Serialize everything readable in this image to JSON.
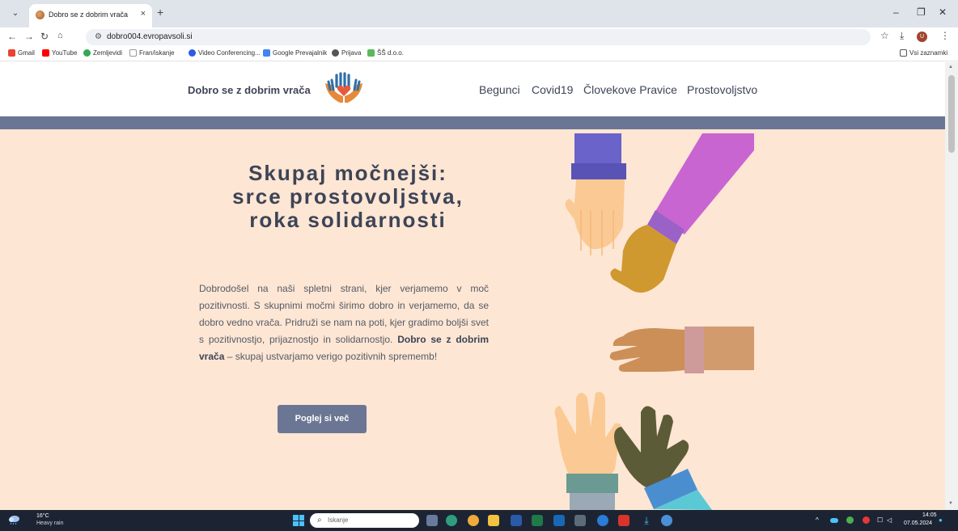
{
  "browser": {
    "tab_title": "Dobro se z dobrim vrača",
    "tab_close": "×",
    "new_tab": "+",
    "url": "dobro004.evropavsoli.si",
    "window_controls": [
      "–",
      "❐",
      "✕"
    ]
  },
  "bookmarks": {
    "items": [
      "Gmail",
      "YouTube",
      "Zemljevidi",
      "Fran/iskanje",
      "Video Conferencing...",
      "Google Prevajalnik",
      "Prijava",
      "ŠŠ d.o.o."
    ],
    "all_bookmarks": "Vsi zaznamki"
  },
  "site": {
    "logo_text": "Dobro se z dobrim vrača",
    "nav": [
      "Begunci",
      "Covid19",
      "Človekove Pravice",
      "Prostovoljstvo"
    ],
    "hero": {
      "title_line1": "Skupaj močnejši:",
      "title_line2": "srce prostovoljstva,",
      "title_line3": "roka solidarnosti",
      "body_part1": "Dobrodošel na naši spletni strani, kjer verjamemo v moč pozitivnosti. S skupnimi močmi širimo dobro in verjamemo, da se dobro vedno vrača. Pridruži se nam na poti, kjer gradimo boljši svet s pozitivnostjo, prijaznostjo in solidarnostjo. ",
      "body_bold": "Dobro se z dobrim vrača",
      "body_part2": " – skupaj ustvarjamo verigo pozitivnih sprememb!",
      "cta": "Poglej si več"
    }
  },
  "colors": {
    "accent": "#6b7694",
    "hero_bg": "#fde6d3",
    "text_dark": "#3d4457"
  },
  "taskbar": {
    "temperature": "16°C",
    "weather": "Heavy rain",
    "search_placeholder": "Iskanje",
    "time": "14:05",
    "date": "07.05.2024"
  }
}
